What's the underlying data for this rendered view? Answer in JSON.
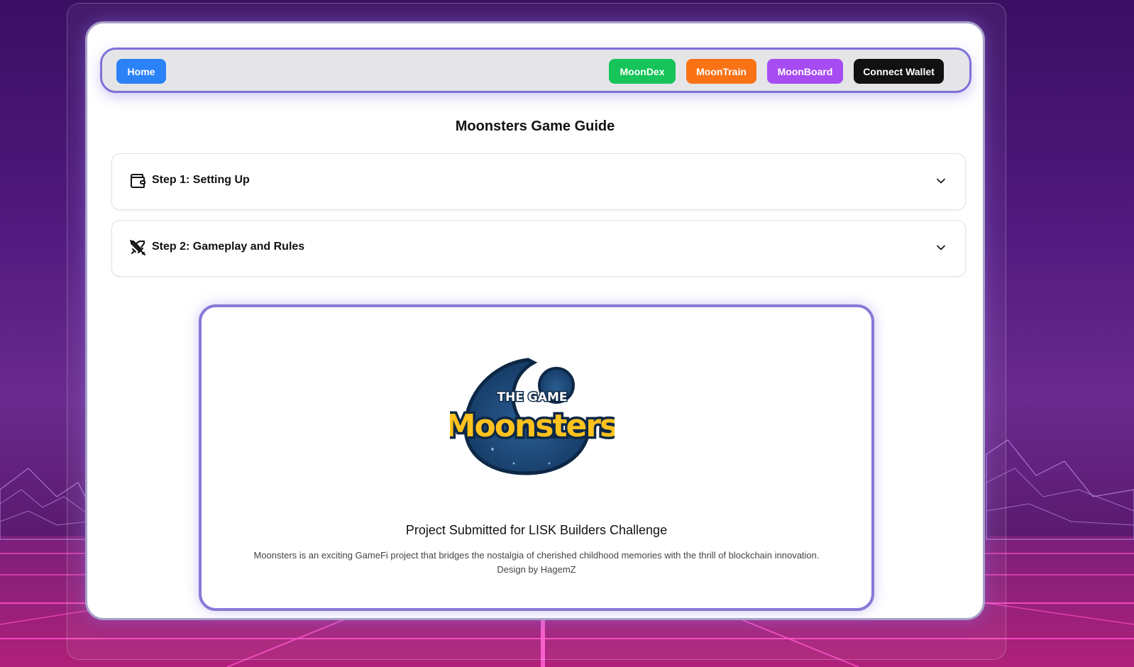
{
  "nav": {
    "home": "Home",
    "moondex": "MoonDex",
    "moontrain": "MoonTrain",
    "moonboard": "MoonBoard",
    "connect": "Connect Wallet"
  },
  "colors": {
    "home": "#2b82f6",
    "moondex": "#16c45a",
    "moontrain": "#f97316",
    "moonboard": "#a64cf2",
    "connect": "#111111",
    "accent": "#8a78d8"
  },
  "page_title": "Moonsters Game Guide",
  "steps": [
    {
      "label": "Step 1: Setting Up",
      "icon": "wallet-icon"
    },
    {
      "label": "Step 2: Gameplay and Rules",
      "icon": "swords-off-icon"
    }
  ],
  "promo": {
    "logo_top": "THE GAME",
    "logo_main": "Moonsters",
    "title": "Project Submitted for LISK Builders Challenge",
    "description": "Moonsters is an exciting GameFi project that bridges the nostalgia of cherished childhood memories with the thrill of blockchain innovation.",
    "credit": "Design by HagemZ"
  }
}
